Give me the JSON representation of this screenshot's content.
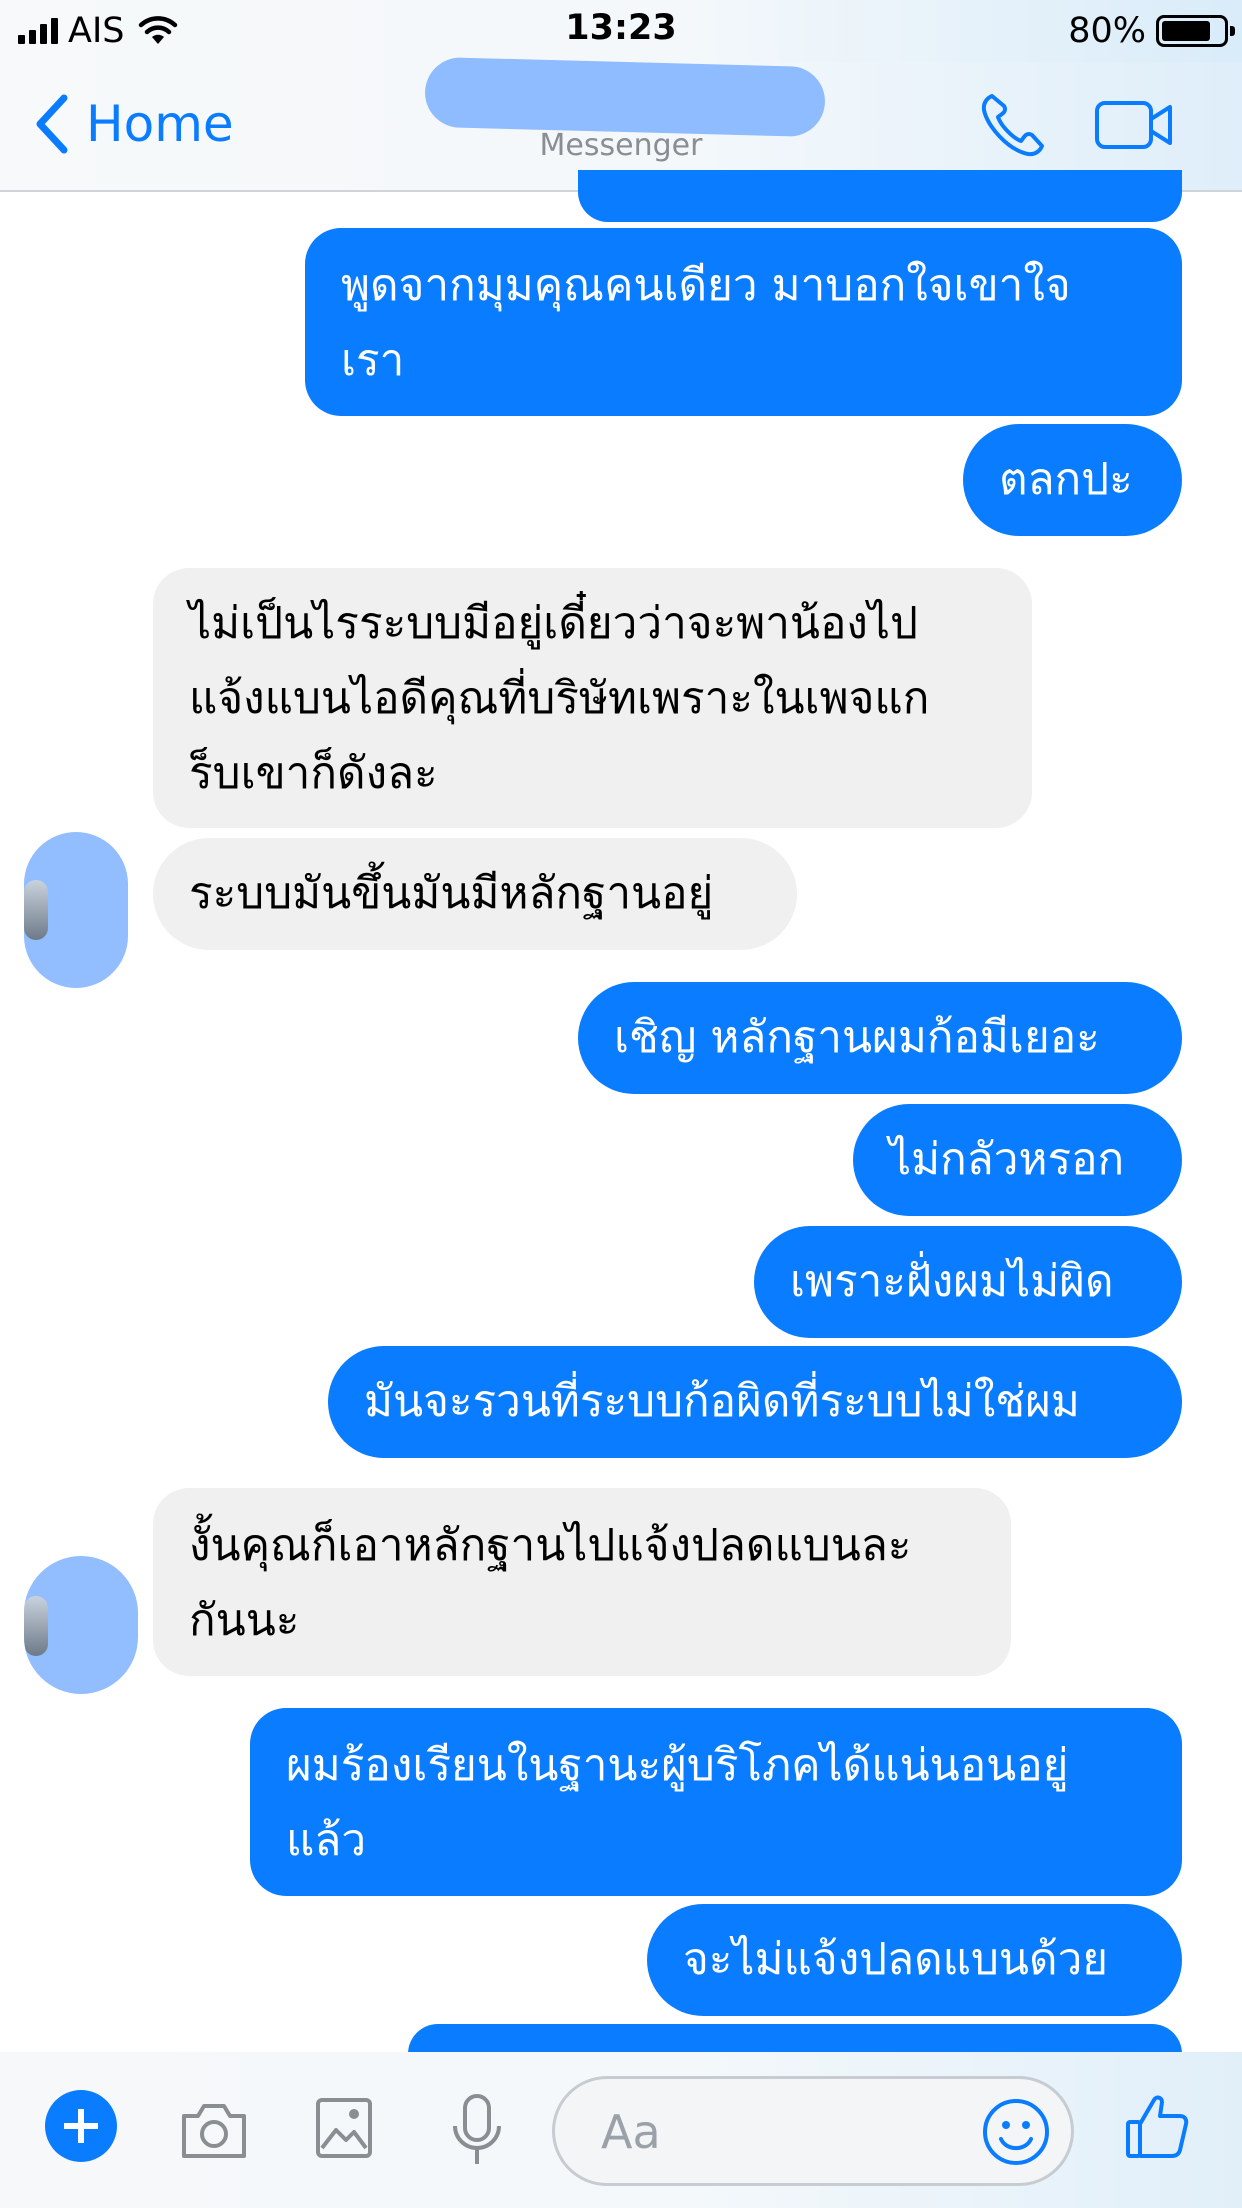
{
  "status_bar": {
    "carrier": "AIS",
    "time": "13:23",
    "battery": "80%",
    "battery_level": 0.8
  },
  "nav": {
    "back_label": "Home",
    "subtitle": "Messenger",
    "icons": [
      "chevron-left-icon",
      "phone-icon",
      "video-camera-icon"
    ]
  },
  "messages": [
    {
      "direction": "outgoing",
      "lines": [
        "พูดจากมุมคุณคนเดียว มาบอกใจเขาใจ",
        "เรา"
      ]
    },
    {
      "direction": "outgoing",
      "lines": [
        "ตลกปะ"
      ]
    },
    {
      "direction": "incoming",
      "lines": [
        "ไม่เป็นไรระบบมีอยู่เดี๋ยวว่าจะพาน้องไป",
        "แจ้งแบนไอดีคุณที่บริษัทเพราะในเพจแก",
        "ร็บเขาก็ดังละ"
      ]
    },
    {
      "direction": "incoming",
      "lines": [
        "ระบบมันขึ้นมันมีหลักฐานอยู่"
      ]
    },
    {
      "direction": "outgoing",
      "lines": [
        "เชิญ หลักฐานผมก้อมีเยอะ"
      ]
    },
    {
      "direction": "outgoing",
      "lines": [
        "ไม่กลัวหรอก"
      ]
    },
    {
      "direction": "outgoing",
      "lines": [
        "เพราะฝั่งผมไม่ผิด"
      ]
    },
    {
      "direction": "outgoing",
      "lines": [
        "มันจะรวนที่ระบบก้อผิดที่ระบบไม่ใช่ผม"
      ]
    },
    {
      "direction": "incoming",
      "lines": [
        "งั้นคุณก็เอาหลักฐานไปแจ้งปลดแบนละ",
        "กันนะ"
      ]
    },
    {
      "direction": "outgoing",
      "lines": [
        "ผมร้องเรียนในฐานะผู้บริโภคได้แน่นอนอยู่",
        "แล้ว"
      ]
    },
    {
      "direction": "outgoing",
      "lines": [
        "จะไม่แจ้งปลดแบนด้วย"
      ]
    }
  ],
  "composer": {
    "placeholder": "Aa",
    "icons": [
      "plus-icon",
      "camera-icon",
      "image-icon",
      "microphone-icon",
      "emoji-icon",
      "thumbs-up-icon"
    ]
  },
  "colors": {
    "accent": "#0a7cff",
    "incoming_bubble": "#f0f0f0",
    "redaction": "#8ebcff"
  }
}
